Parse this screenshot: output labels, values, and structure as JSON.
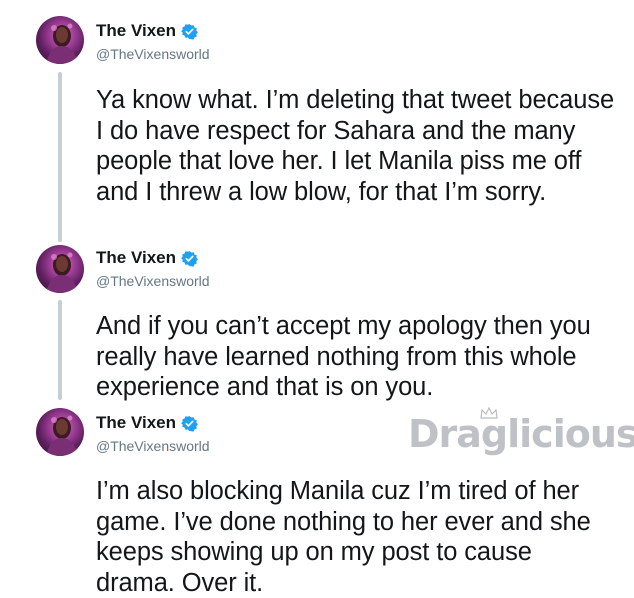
{
  "tweets": [
    {
      "name": "The Vixen",
      "handle": "@TheVixensworld",
      "text": "Ya know what. I’m deleting that tweet because I do have respect for Sahara and the many people that love her. I let Manila piss me off and I threw a low blow, for that I’m sorry."
    },
    {
      "name": "The Vixen",
      "handle": "@TheVixensworld",
      "text": "And if you can’t accept my apology then you really have learned nothing from this whole experience and that is on you."
    },
    {
      "name": "The Vixen",
      "handle": "@TheVixensworld",
      "text": "I’m also blocking Manila cuz I’m tired of her game. I’ve done nothing to her ever and she keeps showing up on my post to cause drama. Over it."
    }
  ],
  "watermark": "Draglicious",
  "colors": {
    "verified": "#1da1f2",
    "thread_line": "#c4cfd6",
    "handle": "#657786"
  }
}
